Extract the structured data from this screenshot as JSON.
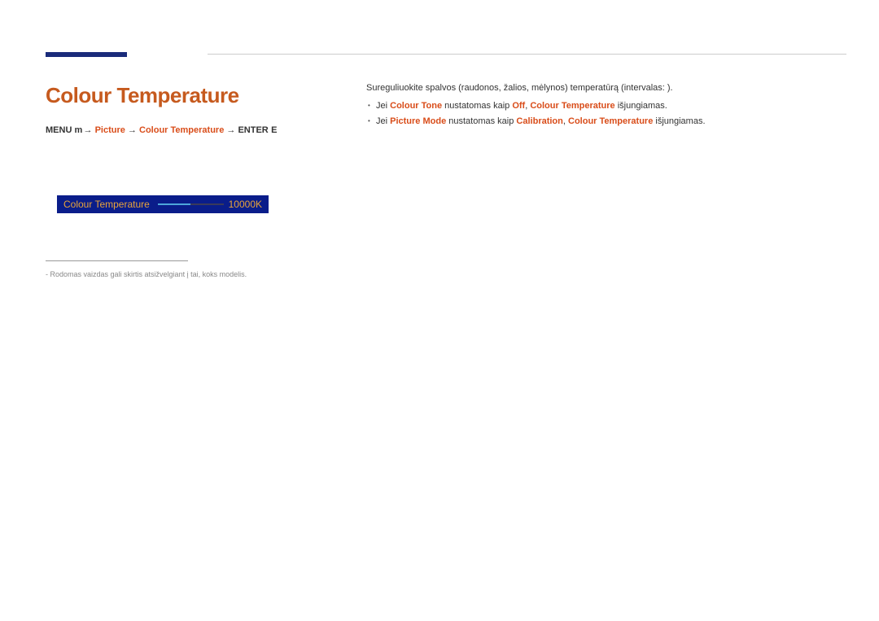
{
  "header": {
    "title": "Colour Temperature"
  },
  "breadcrumb": {
    "menu": "MENU",
    "menu_icon": "m",
    "arrow": "→",
    "picture": "Picture",
    "ct": "Colour Temperature",
    "enter": "ENTER",
    "enter_icon": "E"
  },
  "menu_bar": {
    "label": "Colour Temperature",
    "value": "10000K"
  },
  "footnote": "Rodomas vaizdas gali skirtis atsižvelgiant į tai, koks modelis.",
  "body": {
    "intro": "Sureguliuokite spalvos (raudonos, žalios, mėlynos) temperatūrą (intervalas: ).",
    "b1_pre": "Jei ",
    "b1_h1": "Colour Tone",
    "b1_mid": " nustatomas kaip ",
    "b1_h2": "Off",
    "b1_mid2": ", ",
    "b1_h3": "Colour Temperature",
    "b1_end": " išjungiamas.",
    "b2_pre": "Jei ",
    "b2_h1": "Picture Mode",
    "b2_mid": " nustatomas kaip ",
    "b2_h2": "Calibration",
    "b2_sep": ", ",
    "b2_h3": "Colour Temperature",
    "b2_end": " išjungiamas."
  }
}
